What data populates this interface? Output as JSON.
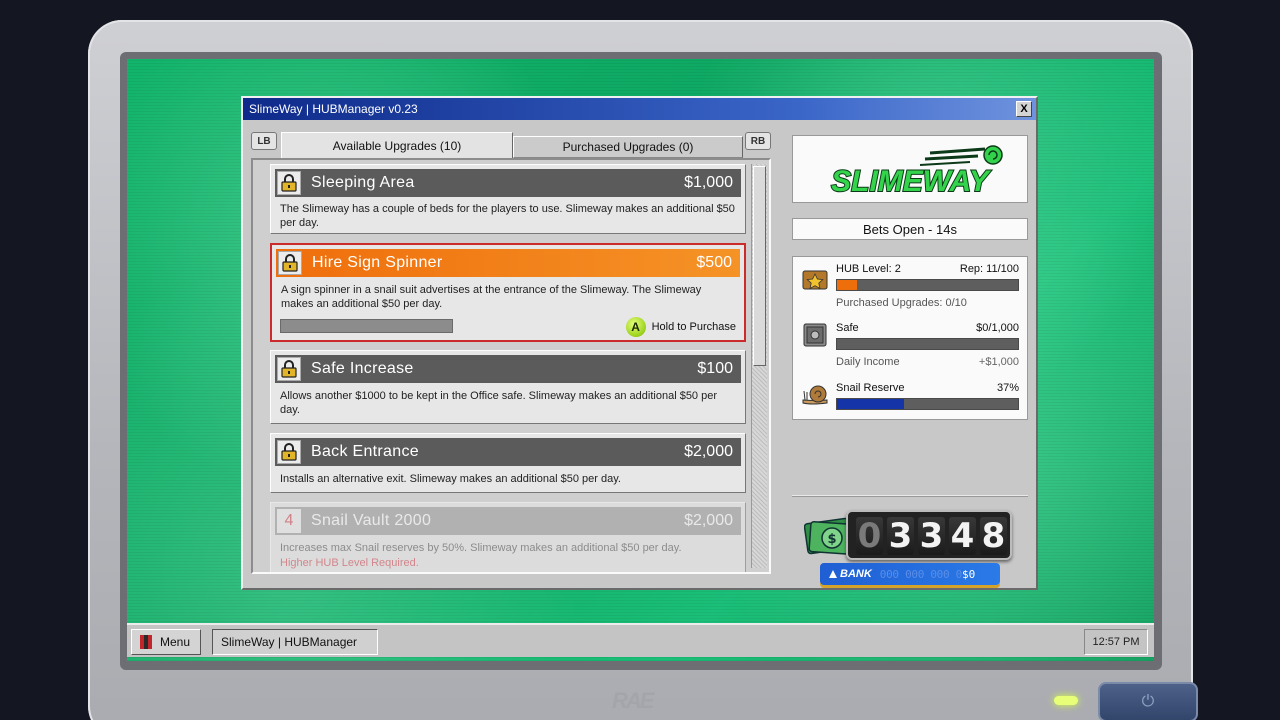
{
  "window": {
    "title": "SlimeWay | HUBManager v0.23",
    "close_label": "X"
  },
  "tabs": {
    "lb": "LB",
    "rb": "RB",
    "available": "Available Upgrades (10)",
    "purchased": "Purchased Upgrades (0)"
  },
  "upgrades": [
    {
      "name": "Sleeping Area",
      "price": "$1,000",
      "desc": "The Slimeway has a couple of beds for the players to use. Slimeway makes an additional $50 per day."
    },
    {
      "name": "Hire Sign Spinner",
      "price": "$500",
      "desc": "A sign spinner in a snail suit advertises at the entrance of the Slimeway. The Slimeway makes an additional $50 per day.",
      "hold_label": "Hold to Purchase",
      "button": "A"
    },
    {
      "name": "Safe Increase",
      "price": "$100",
      "desc": "Allows another $1000 to be kept in the Office safe. Slimeway makes an additional $50 per day."
    },
    {
      "name": "Back Entrance",
      "price": "$2,000",
      "desc": "Installs an alternative exit. Slimeway makes an additional $50 per day."
    },
    {
      "name": "Snail Vault 2000",
      "price": "$2,000",
      "required_level": "4",
      "desc": "Increases max Snail reserves by 50%. Slimeway makes an additional $50 per day.",
      "requirement": "Higher HUB Level Required."
    }
  ],
  "logo_text": "SLIMEWAY",
  "bets_status": "Bets Open - 14s",
  "stats": {
    "hub_level": "HUB Level: 2",
    "rep": "Rep: 11/100",
    "rep_fraction": 0.11,
    "purchased": "Purchased Upgrades: 0/10",
    "safe_label": "Safe",
    "safe_value": "$0/1,000",
    "safe_fraction": 0.0,
    "daily_income_label": "Daily Income",
    "daily_income_value": "+$1,000",
    "snail_label": "Snail Reserve",
    "snail_value": "37%",
    "snail_fraction": 0.37
  },
  "cash": {
    "digits": [
      "0",
      "3",
      "3",
      "4",
      "8"
    ],
    "bank_label": "BANK",
    "bank_number": "000 000 000 0",
    "bank_value": "$0"
  },
  "colors": {
    "rep_bar": "#ef6e0c",
    "snail_bar": "#1434a8",
    "accent": "#f08a1c"
  },
  "taskbar": {
    "menu": "Menu",
    "task": "SlimeWay | HUBManager",
    "clock": "12:57 PM"
  },
  "monitor": {
    "brand": "RAE"
  }
}
